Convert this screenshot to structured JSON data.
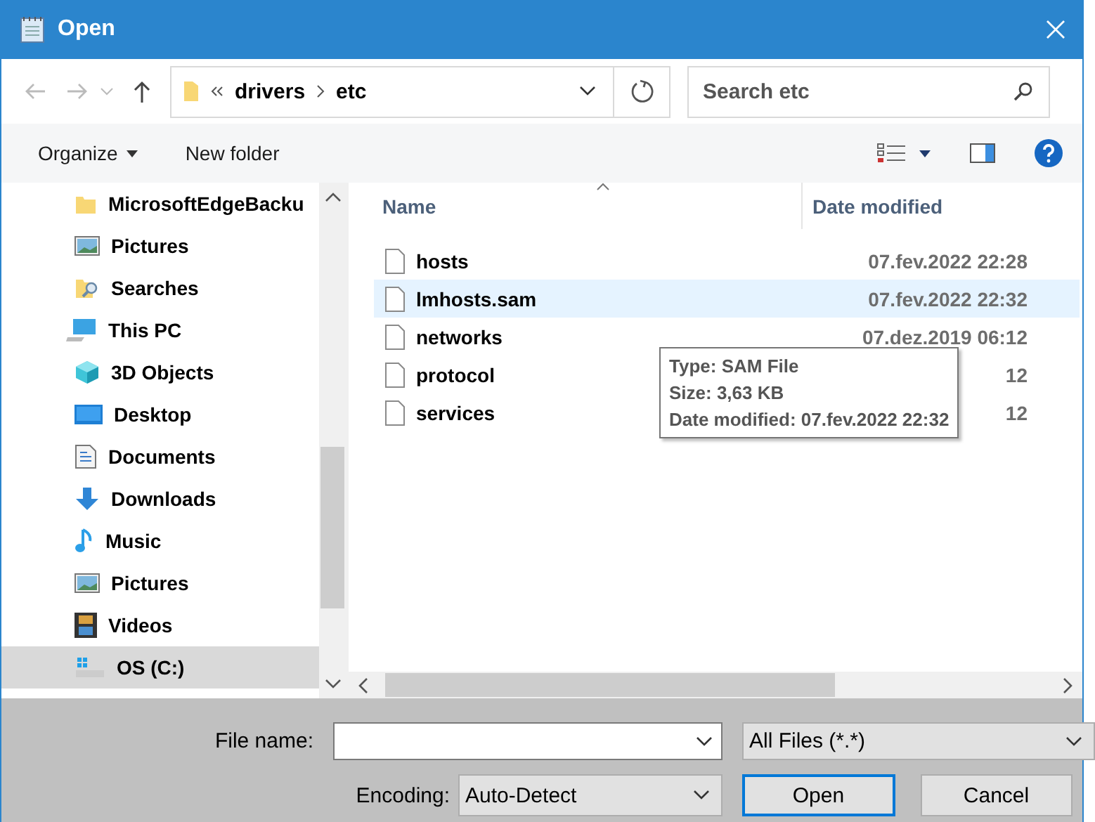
{
  "window": {
    "title": "Open"
  },
  "address": {
    "path": [
      "drivers",
      "etc"
    ]
  },
  "search": {
    "placeholder": "Search etc"
  },
  "toolbar": {
    "organize": "Organize",
    "new_folder": "New folder"
  },
  "sidebar": {
    "items": [
      {
        "label": "MicrosoftEdgeBacku",
        "kind": "folder",
        "selected": false
      },
      {
        "label": "Pictures",
        "kind": "pictures",
        "selected": false
      },
      {
        "label": "Searches",
        "kind": "searches",
        "selected": false
      },
      {
        "label": "This PC",
        "kind": "pc",
        "selected": false,
        "children": [
          {
            "label": "3D Objects",
            "kind": "objects",
            "selected": false
          },
          {
            "label": "Desktop",
            "kind": "desktop",
            "selected": false
          },
          {
            "label": "Documents",
            "kind": "documents",
            "selected": false
          },
          {
            "label": "Downloads",
            "kind": "downloads",
            "selected": false
          },
          {
            "label": "Music",
            "kind": "music",
            "selected": false
          },
          {
            "label": "Pictures",
            "kind": "pictures",
            "selected": false
          },
          {
            "label": "Videos",
            "kind": "videos",
            "selected": false
          },
          {
            "label": "OS (C:)",
            "kind": "drive",
            "selected": true
          }
        ]
      }
    ]
  },
  "file_list": {
    "columns": [
      "Name",
      "Date modified"
    ],
    "rows": [
      {
        "name": "hosts",
        "date": "07.fev.2022 22:28",
        "hovered": false
      },
      {
        "name": "lmhosts.sam",
        "date": "07.fev.2022 22:32",
        "hovered": true
      },
      {
        "name": "networks",
        "date": "07.dez.2019 06:12",
        "hovered": false
      },
      {
        "name": "protocol",
        "date": "12",
        "hovered": false
      },
      {
        "name": "services",
        "date": "12",
        "hovered": false
      }
    ]
  },
  "tooltip": {
    "lines": [
      "Type: SAM File",
      "Size: 3,63 KB",
      "Date modified: 07.fev.2022 22:32"
    ]
  },
  "file_name": {
    "label": "File name:"
  },
  "file_type": {
    "value": "All Files  (*.*)"
  },
  "encoding": {
    "label": "Encoding:",
    "value": "Auto-Detect"
  },
  "buttons": [
    {
      "label": "Open",
      "default": true
    },
    {
      "label": "Cancel",
      "default": false
    }
  ]
}
